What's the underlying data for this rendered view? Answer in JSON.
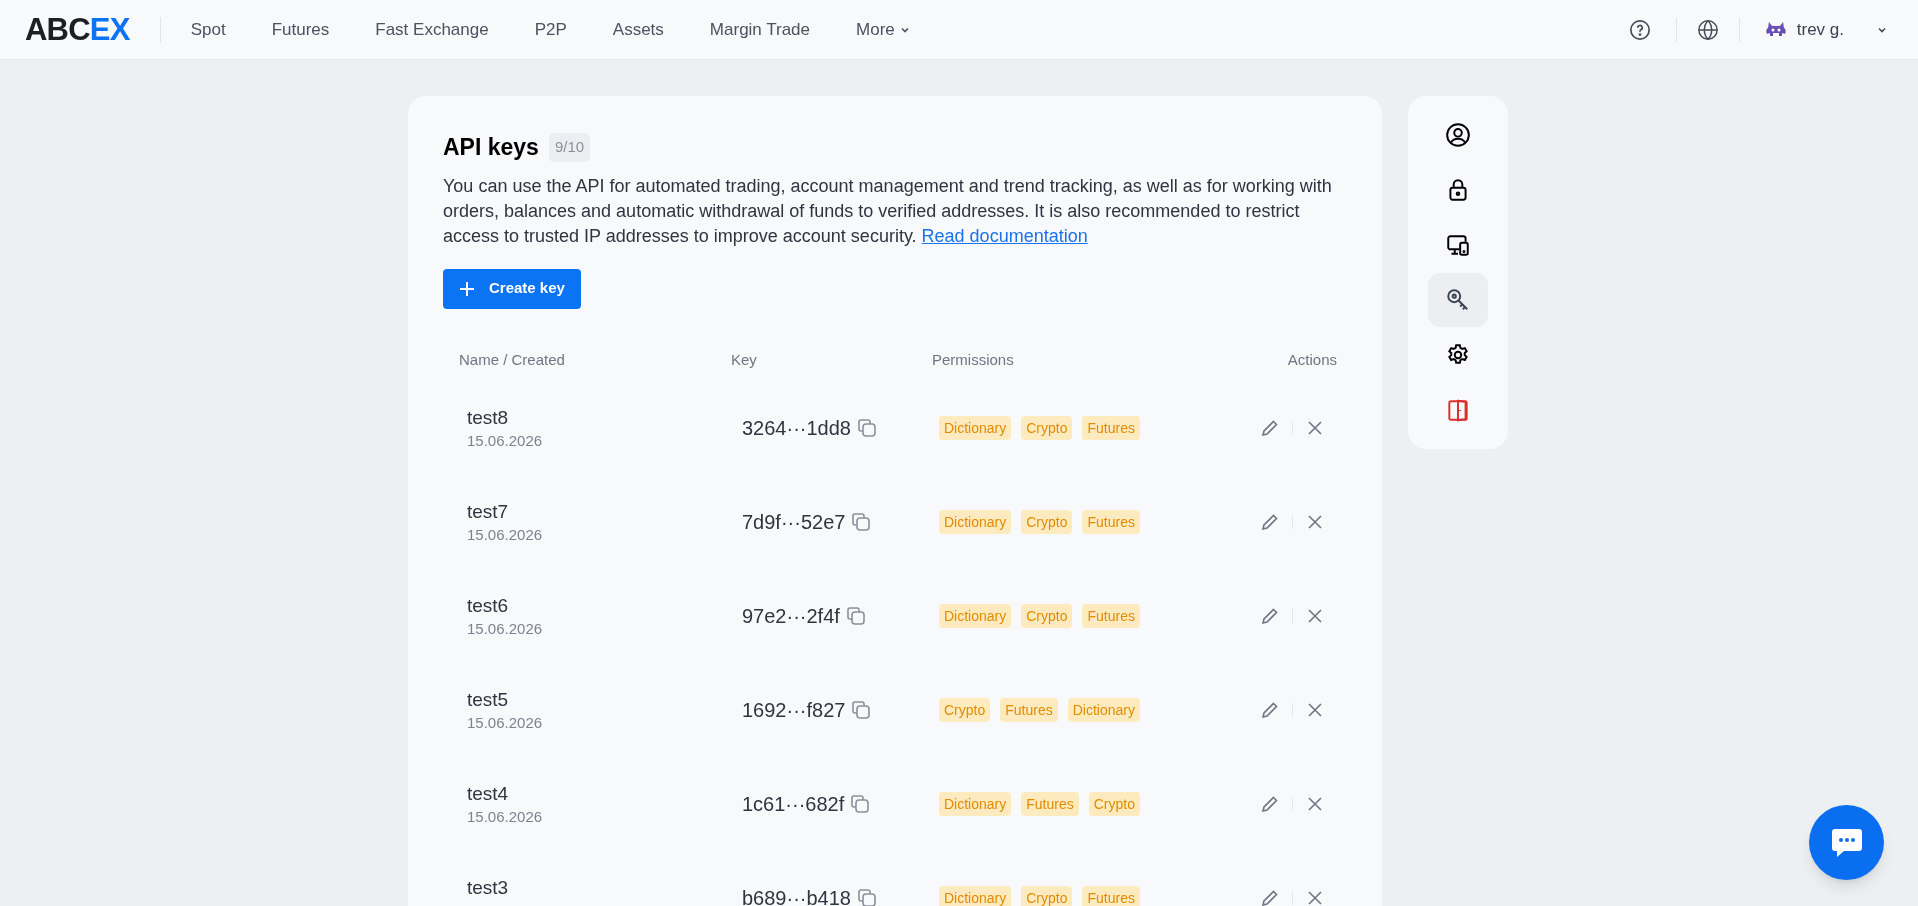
{
  "header": {
    "logo": {
      "part_1": "ABC",
      "part_2": "EX"
    },
    "nav": [
      {
        "label": "Spot",
        "dropdown": false
      },
      {
        "label": "Futures",
        "dropdown": false
      },
      {
        "label": "Fast Exchange",
        "dropdown": false
      },
      {
        "label": "P2P",
        "dropdown": false
      },
      {
        "label": "Assets",
        "dropdown": false
      },
      {
        "label": "Margin Trade",
        "dropdown": false
      },
      {
        "label": "More",
        "dropdown": true
      }
    ],
    "user": {
      "name": "trev g."
    }
  },
  "api_keys": {
    "title": "API keys",
    "count": "9/10",
    "description": "You can use the API for automated trading, account management and trend tracking, as well as for working with orders, balances and automatic withdrawal of funds to verified addresses. It is also recommended to restrict access to trusted IP addresses to improve account security.",
    "doc_link": "Read documentation",
    "create_button": "Create key",
    "table": {
      "columns": [
        "Name / Created",
        "Key",
        "Permissions",
        "Actions"
      ],
      "rows": [
        {
          "name": "test8",
          "created": "15.06.2026",
          "key": "3264···1dd8",
          "permissions": [
            "Dictionary",
            "Crypto",
            "Futures"
          ]
        },
        {
          "name": "test7",
          "created": "15.06.2026",
          "key": "7d9f···52e7",
          "permissions": [
            "Dictionary",
            "Crypto",
            "Futures"
          ]
        },
        {
          "name": "test6",
          "created": "15.06.2026",
          "key": "97e2···2f4f",
          "permissions": [
            "Dictionary",
            "Crypto",
            "Futures"
          ]
        },
        {
          "name": "test5",
          "created": "15.06.2026",
          "key": "1692···f827",
          "permissions": [
            "Crypto",
            "Futures",
            "Dictionary"
          ]
        },
        {
          "name": "test4",
          "created": "15.06.2026",
          "key": "1c61···682f",
          "permissions": [
            "Dictionary",
            "Futures",
            "Crypto"
          ]
        },
        {
          "name": "test3",
          "key": "b689···b418",
          "permissions": [
            "Dictionary",
            "Crypto",
            "Futures"
          ]
        }
      ]
    }
  },
  "side_menu": [
    {
      "kind": "profile",
      "selected": false
    },
    {
      "kind": "security",
      "selected": false
    },
    {
      "kind": "devices",
      "selected": false
    },
    {
      "kind": "api",
      "selected": true
    },
    {
      "kind": "settings",
      "selected": false
    },
    {
      "kind": "logout",
      "selected": false
    }
  ]
}
